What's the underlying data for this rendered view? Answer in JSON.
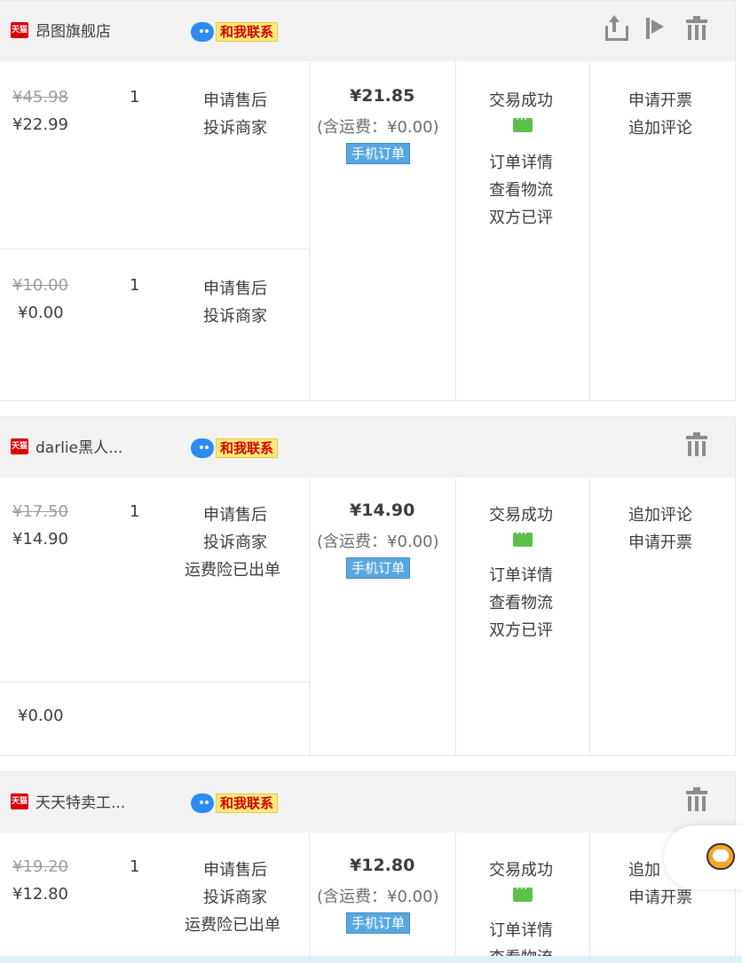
{
  "contact_label": "和我联系",
  "mobile_order_label": "手机订单",
  "shop_badge": "天猫",
  "orders": [
    {
      "shop_name": "昂图旗舰店",
      "items": [
        {
          "orig_price": "¥45.98",
          "price": "¥22.99",
          "qty": "1",
          "ops": [
            "申请售后",
            "投诉商家"
          ]
        },
        {
          "orig_price": "¥10.00",
          "price": "¥0.00",
          "qty": "1",
          "ops": [
            "申请售后",
            "投诉商家"
          ]
        }
      ],
      "total": "¥21.85",
      "shipping": "(含运费：¥0.00)",
      "status": [
        "交易成功",
        "订单详情",
        "查看物流",
        "双方已评"
      ],
      "actions": [
        "申请开票",
        "追加评论"
      ]
    },
    {
      "shop_name": "darlie黑人...",
      "items": [
        {
          "orig_price": "¥17.50",
          "price": "¥14.90",
          "qty": "1",
          "ops": [
            "申请售后",
            "投诉商家",
            "运费险已出单"
          ]
        },
        {
          "orig_price": "",
          "price": "¥0.00",
          "qty": "",
          "ops": []
        }
      ],
      "total": "¥14.90",
      "shipping": "(含运费：¥0.00)",
      "status": [
        "交易成功",
        "订单详情",
        "查看物流",
        "双方已评"
      ],
      "actions": [
        "追加评论",
        "申请开票"
      ]
    },
    {
      "shop_name": "天天特卖工...",
      "items": [
        {
          "orig_price": "¥19.20",
          "price": "¥12.80",
          "qty": "1",
          "ops": [
            "申请售后",
            "投诉商家",
            "运费险已出单"
          ]
        }
      ],
      "total": "¥12.80",
      "shipping": "(含运费：¥0.00)",
      "status": [
        "交易成功",
        "订单详情",
        "查看物流"
      ],
      "actions": [
        "追加",
        "申请开票"
      ]
    }
  ]
}
